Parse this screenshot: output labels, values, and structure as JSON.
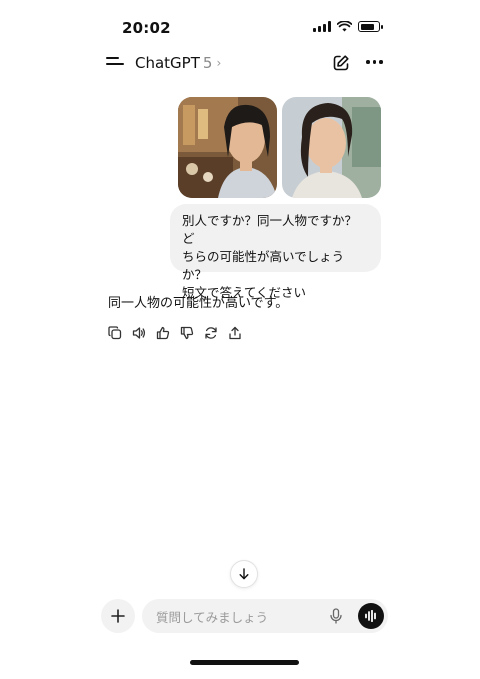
{
  "status_bar": {
    "time": "20:02"
  },
  "header": {
    "app_name": "ChatGPT",
    "model_version": "5",
    "menu_icon": "hamburger-icon",
    "new_chat_icon": "edit-icon",
    "more_icon": "more-dots-icon"
  },
  "conversation": {
    "user_message": {
      "images": [
        {
          "icon": "photo-thumbnail"
        },
        {
          "icon": "photo-thumbnail"
        }
      ],
      "lines": [
        "別人ですか？同一人物ですか？ど",
        "ちらの可能性が高いでしょうか？",
        "短文で答えてください"
      ]
    },
    "assistant_message": {
      "text": "同一人物の可能性が高いです。",
      "actions": [
        "copy-icon",
        "speaker-icon",
        "thumbs-up-icon",
        "thumbs-down-icon",
        "regenerate-icon",
        "share-icon"
      ]
    }
  },
  "composer": {
    "placeholder": "質問してみましょう",
    "value": "",
    "attach_icon": "plus-icon",
    "mic_icon": "mic-icon",
    "voice_icon": "voice-waveform-icon"
  },
  "colors": {
    "background": "#ffffff",
    "bubble": "#f1f1f1",
    "input_bg": "#f2f2f2",
    "text": "#111111",
    "muted": "#8a8a8a"
  }
}
